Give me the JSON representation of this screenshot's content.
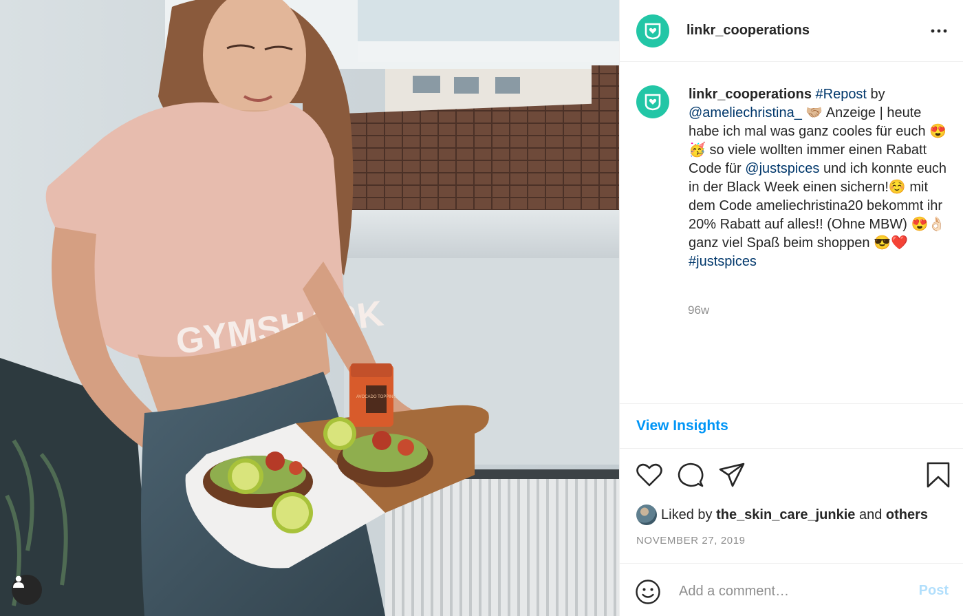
{
  "post": {
    "username": "linkr_cooperations",
    "caption": {
      "username": "linkr_cooperations",
      "repost_tag": "#Repost",
      "by_text": " by ",
      "mention_1": "@ameliechristina_",
      "mention_1_emoji": " 🤝🏼",
      "text_1": "Anzeige | heute habe ich mal was ganz cooles für euch 😍🥳 so viele wollten immer einen Rabatt Code für ",
      "mention_2": "@justspices",
      "text_2": " und ich konnte euch in der Black Week einen sichern!☺️ mit dem Code ameliechristina20 bekommt ihr 20% Rabatt auf alles!! (Ohne MBW) 😍👌🏻 ganz viel Spaß beim shoppen 😎❤️",
      "hashtag": "#justspices"
    },
    "age": "96w",
    "insights_label": "View Insights",
    "liked_by_prefix": "Liked by ",
    "liked_by_user": "the_skin_care_junkie",
    "liked_by_and": " and ",
    "liked_by_others": "others",
    "date": "NOVEMBER 27, 2019",
    "comment_placeholder": "Add a comment…",
    "post_label": "Post"
  },
  "photo": {
    "shirt_print": "GYMSHARK",
    "jar_label": "AVOCADO TOPPING"
  },
  "colors": {
    "brand_teal": "#22c6a6",
    "link_blue": "#0095f6",
    "mention_navy": "#00376b",
    "post_disabled": "#b2dffc"
  },
  "icons": [
    "heart-icon",
    "comment-icon",
    "share-icon",
    "bookmark-icon",
    "more-icon",
    "emoji-icon",
    "user-tag-icon",
    "brand-logo-icon"
  ]
}
